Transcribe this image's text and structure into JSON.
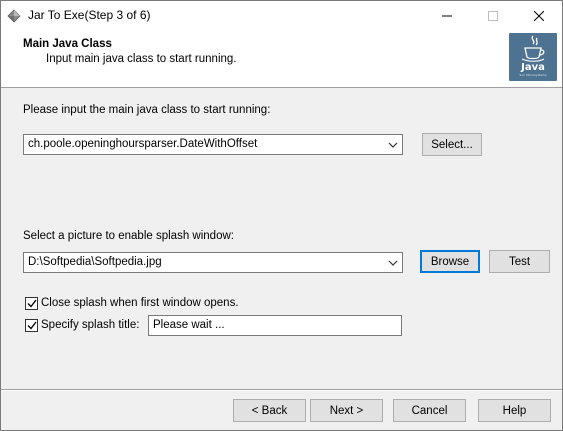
{
  "window": {
    "title": "Jar To Exe(Step 3 of 6)",
    "app_icon": "gem-icon"
  },
  "header": {
    "title": "Main Java Class",
    "subtitle": "Input main java class to start running.",
    "logo": {
      "icon": "java-coffee-cup-icon",
      "word": "Java",
      "tagline": "Sun Microsystems"
    }
  },
  "main_class": {
    "prompt": "Please input the main java class to start running:",
    "value": "ch.poole.openinghoursparser.DateWithOffset",
    "select_label": "Select..."
  },
  "splash": {
    "prompt": "Select a picture to enable splash window:",
    "path": "D:\\Softpedia\\Softpedia.jpg",
    "browse_label": "Browse",
    "test_label": "Test",
    "close_splash_label": "Close splash when first window opens.",
    "close_splash_checked": true,
    "specify_title_label": "Specify splash title:",
    "specify_title_checked": true,
    "title_value": "Please wait ..."
  },
  "footer": {
    "back_label": "< Back",
    "next_label": "Next >",
    "cancel_label": "Cancel",
    "help_label": "Help"
  },
  "colors": {
    "window_bg": "#f0f0f0",
    "header_bg": "#ffffff",
    "button_bg": "#e1e1e1",
    "focus_accent": "#0078d7",
    "java_logo_bg": "#4e7291"
  }
}
